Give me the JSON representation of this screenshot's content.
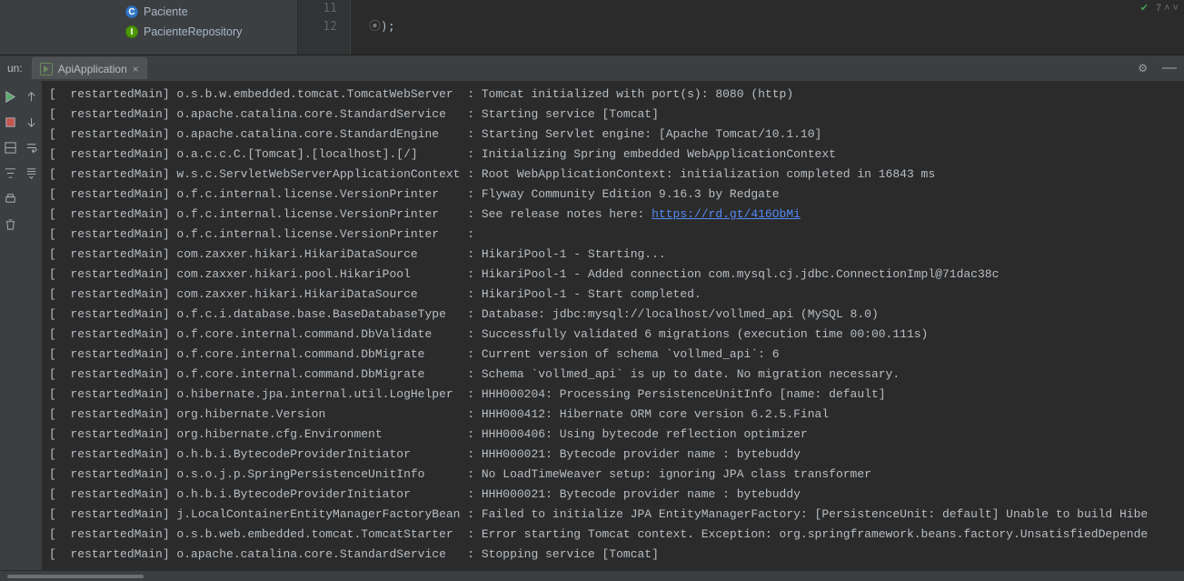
{
  "project_tree": {
    "items": [
      {
        "icon": "class",
        "label": "Paciente"
      },
      {
        "icon": "interface",
        "label": "PacienteRepository"
      }
    ]
  },
  "editor": {
    "line_nums": [
      "11",
      "12"
    ],
    "line12_text": ");",
    "inspections": "7"
  },
  "run_panel": {
    "label": "un:",
    "tab": "ApiApplication"
  },
  "console_lines": [
    {
      "b": "[  restartedMain] ",
      "src": "o.s.b.w.embedded.tomcat.TomcatWebServer  ",
      "msg": "Tomcat initialized with port(s): 8080 (http)"
    },
    {
      "b": "[  restartedMain] ",
      "src": "o.apache.catalina.core.StandardService   ",
      "msg": "Starting service [Tomcat]"
    },
    {
      "b": "[  restartedMain] ",
      "src": "o.apache.catalina.core.StandardEngine    ",
      "msg": "Starting Servlet engine: [Apache Tomcat/10.1.10]"
    },
    {
      "b": "[  restartedMain] ",
      "src": "o.a.c.c.C.[Tomcat].[localhost].[/]       ",
      "msg": "Initializing Spring embedded WebApplicationContext"
    },
    {
      "b": "[  restartedMain] ",
      "src": "w.s.c.ServletWebServerApplicationContext ",
      "msg": "Root WebApplicationContext: initialization completed in 16843 ms"
    },
    {
      "b": "[  restartedMain] ",
      "src": "o.f.c.internal.license.VersionPrinter    ",
      "msg": "Flyway Community Edition 9.16.3 by Redgate"
    },
    {
      "b": "[  restartedMain] ",
      "src": "o.f.c.internal.license.VersionPrinter    ",
      "msg": "See release notes here: ",
      "link": "https://rd.gt/416ObMi"
    },
    {
      "b": "[  restartedMain] ",
      "src": "o.f.c.internal.license.VersionPrinter    ",
      "msg": ""
    },
    {
      "b": "[  restartedMain] ",
      "src": "com.zaxxer.hikari.HikariDataSource       ",
      "msg": "HikariPool-1 - Starting..."
    },
    {
      "b": "[  restartedMain] ",
      "src": "com.zaxxer.hikari.pool.HikariPool        ",
      "msg": "HikariPool-1 - Added connection com.mysql.cj.jdbc.ConnectionImpl@71dac38c"
    },
    {
      "b": "[  restartedMain] ",
      "src": "com.zaxxer.hikari.HikariDataSource       ",
      "msg": "HikariPool-1 - Start completed."
    },
    {
      "b": "[  restartedMain] ",
      "src": "o.f.c.i.database.base.BaseDatabaseType   ",
      "msg": "Database: jdbc:mysql://localhost/vollmed_api (MySQL 8.0)"
    },
    {
      "b": "[  restartedMain] ",
      "src": "o.f.core.internal.command.DbValidate     ",
      "msg": "Successfully validated 6 migrations (execution time 00:00.111s)"
    },
    {
      "b": "[  restartedMain] ",
      "src": "o.f.core.internal.command.DbMigrate      ",
      "msg": "Current version of schema `vollmed_api`: 6"
    },
    {
      "b": "[  restartedMain] ",
      "src": "o.f.core.internal.command.DbMigrate      ",
      "msg": "Schema `vollmed_api` is up to date. No migration necessary."
    },
    {
      "b": "[  restartedMain] ",
      "src": "o.hibernate.jpa.internal.util.LogHelper  ",
      "msg": "HHH000204: Processing PersistenceUnitInfo [name: default]"
    },
    {
      "b": "[  restartedMain] ",
      "src": "org.hibernate.Version                    ",
      "msg": "HHH000412: Hibernate ORM core version 6.2.5.Final"
    },
    {
      "b": "[  restartedMain] ",
      "src": "org.hibernate.cfg.Environment            ",
      "msg": "HHH000406: Using bytecode reflection optimizer"
    },
    {
      "b": "[  restartedMain] ",
      "src": "o.h.b.i.BytecodeProviderInitiator        ",
      "msg": "HHH000021: Bytecode provider name : bytebuddy"
    },
    {
      "b": "[  restartedMain] ",
      "src": "o.s.o.j.p.SpringPersistenceUnitInfo      ",
      "msg": "No LoadTimeWeaver setup: ignoring JPA class transformer"
    },
    {
      "b": "[  restartedMain] ",
      "src": "o.h.b.i.BytecodeProviderInitiator        ",
      "msg": "HHH000021: Bytecode provider name : bytebuddy"
    },
    {
      "b": "[  restartedMain] ",
      "src": "j.LocalContainerEntityManagerFactoryBean ",
      "msg": "Failed to initialize JPA EntityManagerFactory: [PersistenceUnit: default] Unable to build Hibe"
    },
    {
      "b": "[  restartedMain] ",
      "src": "o.s.b.web.embedded.tomcat.TomcatStarter  ",
      "msg": "Error starting Tomcat context. Exception: org.springframework.beans.factory.UnsatisfiedDepende"
    },
    {
      "b": "[  restartedMain] ",
      "src": "o.apache.catalina.core.StandardService   ",
      "msg": "Stopping service [Tomcat]"
    }
  ]
}
